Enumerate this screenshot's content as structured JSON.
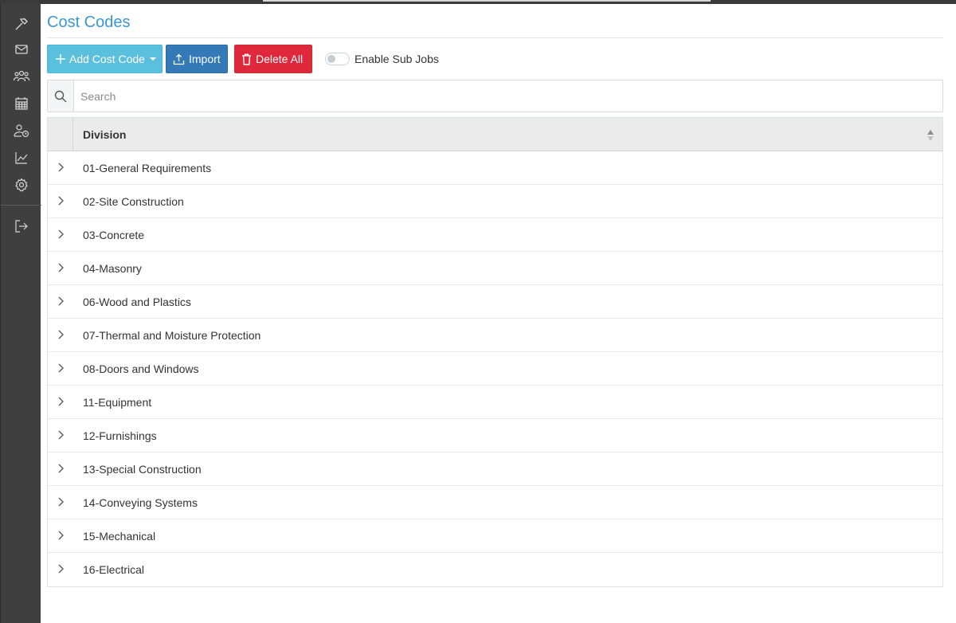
{
  "sidebar": {
    "icons": [
      "hammer-icon",
      "mail-icon",
      "users-icon",
      "calendar-icon",
      "user-clock-icon",
      "chart-line-icon",
      "gear-icon",
      "logout-icon"
    ]
  },
  "page": {
    "title": "Cost Codes"
  },
  "toolbar": {
    "add_label": "Add Cost Code",
    "import_label": "Import",
    "delete_label": "Delete All",
    "toggle_label": "Enable Sub Jobs",
    "toggle_on": false
  },
  "search": {
    "placeholder": "Search",
    "value": ""
  },
  "table": {
    "header": "Division",
    "rows": [
      "01-General Requirements",
      "02-Site Construction",
      "03-Concrete",
      "04-Masonry",
      "06-Wood and Plastics",
      "07-Thermal and Moisture Protection",
      "08-Doors and Windows",
      "11-Equipment",
      "12-Furnishings",
      "13-Special Construction",
      "14-Conveying Systems",
      "15-Mechanical",
      "16-Electrical"
    ]
  },
  "colors": {
    "title": "#3a97d4",
    "add_button": "#5bc0de",
    "import_button": "#337ab7",
    "delete_button": "#e0283c",
    "sidebar": "#3f3f3f"
  }
}
